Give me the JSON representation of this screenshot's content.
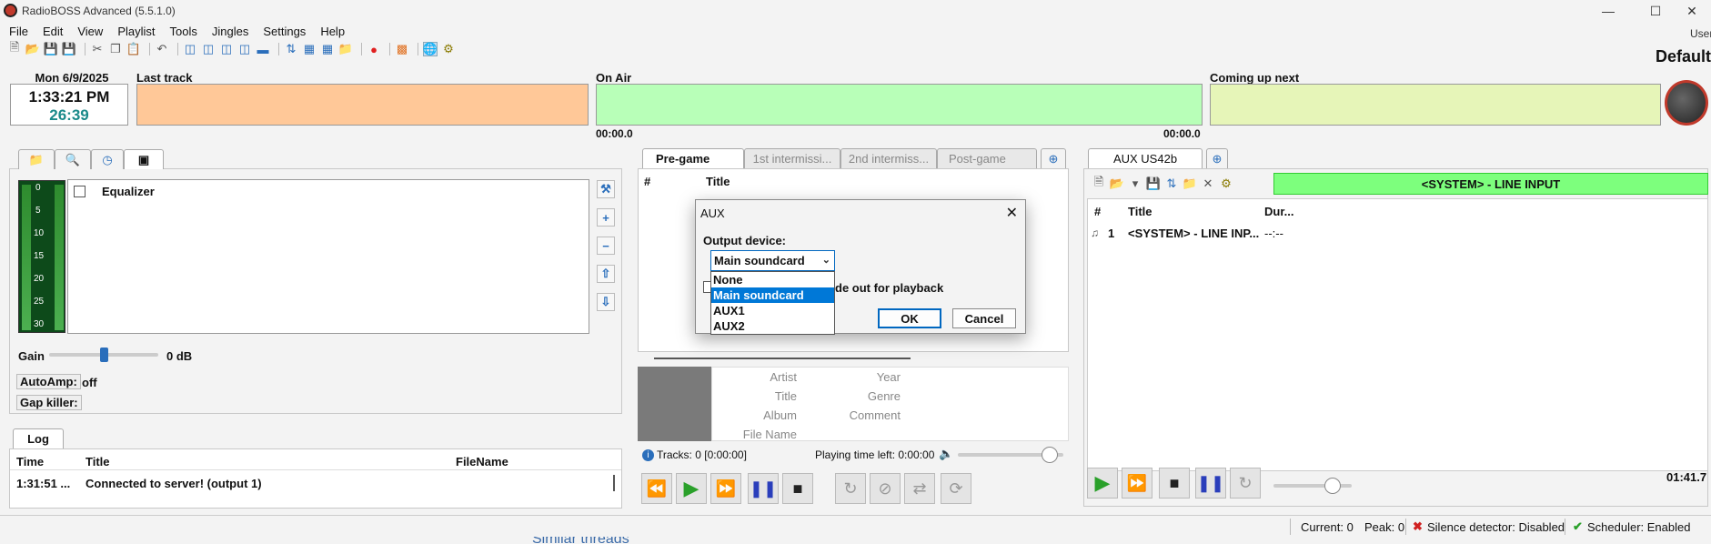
{
  "window": {
    "title": "RadioBOSS Advanced (5.5.1.0)",
    "user_label": "User"
  },
  "menu": [
    "File",
    "Edit",
    "View",
    "Playlist",
    "Tools",
    "Jingles",
    "Settings",
    "Help"
  ],
  "profile": "Default",
  "clock": {
    "date": "Mon 6/9/2025",
    "time": "1:33:21 PM",
    "countdown": "26:39"
  },
  "now": {
    "last_track_label": "Last track",
    "on_air_label": "On Air",
    "on_air_elapsed": "00:00.0",
    "on_air_remaining": "00:00.0",
    "coming_up_label": "Coming up next"
  },
  "left_panel": {
    "vu_ticks": [
      "0",
      "5",
      "10",
      "15",
      "20",
      "25",
      "30"
    ],
    "equalizer_label": "Equalizer",
    "gain_label": "Gain",
    "gain_value": "0 dB",
    "gain_level_percent": 50,
    "autoamp_label": "AutoAmp:",
    "autoamp_value": "off",
    "gapkiller_label": "Gap killer:"
  },
  "log": {
    "tab": "Log",
    "columns": [
      "Time",
      "Title",
      "FileName"
    ],
    "rows": [
      {
        "time": "1:31:51 ...",
        "title": "Connected to server! (output 1)",
        "file": ""
      }
    ]
  },
  "playlist": {
    "tabs": [
      "Pre-game",
      "1st intermissi...",
      "2nd intermiss...",
      "Post-game"
    ],
    "columns": [
      "#",
      "Title"
    ],
    "meta_labels": {
      "artist": "Artist",
      "title": "Title",
      "album": "Album",
      "file": "File Name",
      "year": "Year",
      "genre": "Genre",
      "comment": "Comment"
    },
    "tracks_info": "Tracks: 0 [0:00:00]",
    "playing_time_left": "Playing time left: 0:00:00",
    "volume_percent": 87
  },
  "aux_dialog": {
    "title": "AUX",
    "device_label": "Output device:",
    "selected": "Main soundcard",
    "options": [
      "None",
      "Main soundcard",
      "AUX1",
      "AUX2"
    ],
    "checkbox_text": "de out for playback",
    "ok": "OK",
    "cancel": "Cancel"
  },
  "aux_panel": {
    "tab": "AUX US42b",
    "system_input": "<SYSTEM> - LINE INPUT",
    "columns": [
      "#",
      "Title",
      "Dur..."
    ],
    "rows": [
      {
        "num": "1",
        "title": "<SYSTEM> - LINE INP...",
        "dur": "--:--"
      }
    ],
    "elapsed": "01:41.7",
    "volume_percent": 75
  },
  "statusbar": {
    "current": "Current: 0",
    "peak": "Peak: 0",
    "silence": "Silence detector: Disabled",
    "scheduler": "Scheduler: Enabled"
  },
  "background_text": "Similar threads",
  "colors": {
    "last_track": "#ffc898",
    "on_air": "#b8ffb8",
    "coming_up": "#e6f5b8",
    "selection": "#0078d7"
  }
}
